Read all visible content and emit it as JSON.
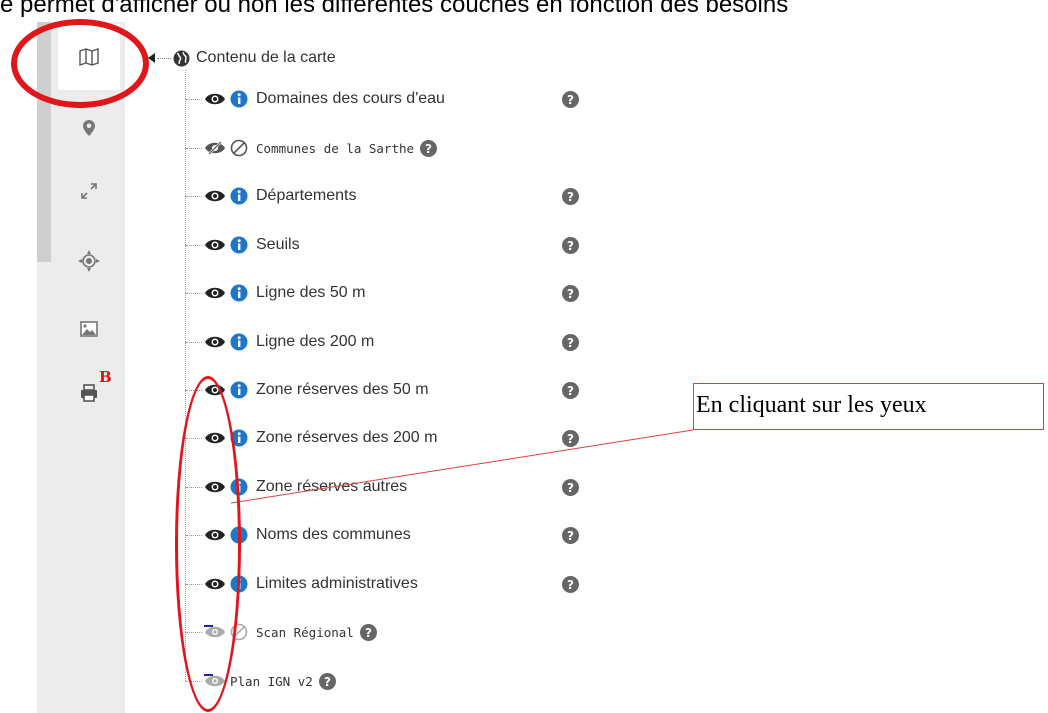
{
  "caption": {
    "text": "e permet d'afficher ou non les différentes couches en fonction des besoins"
  },
  "sidebar": {
    "tools": [
      {
        "id": "map",
        "icon": "map-icon",
        "active": true
      },
      {
        "id": "marker",
        "icon": "map-marker-icon",
        "active": false
      },
      {
        "id": "fullscreen",
        "icon": "expand-icon",
        "active": false
      },
      {
        "id": "locate",
        "icon": "crosshair-icon",
        "active": false
      },
      {
        "id": "image",
        "icon": "image-icon",
        "active": false
      },
      {
        "id": "print",
        "icon": "print-icon",
        "active": false,
        "badge": "B"
      }
    ]
  },
  "tree": {
    "root_label": "Contenu de la carte",
    "layers": [
      {
        "label": "Domaines des cours d'eau",
        "visible": true,
        "info": true,
        "small": false
      },
      {
        "label": "Communes de la Sarthe",
        "visible": false,
        "info": false,
        "small": true
      },
      {
        "label": "Départements",
        "visible": true,
        "info": true,
        "small": false
      },
      {
        "label": "Seuils",
        "visible": true,
        "info": true,
        "small": false
      },
      {
        "label": "Ligne des 50 m",
        "visible": true,
        "info": true,
        "small": false
      },
      {
        "label": "Ligne des 200 m",
        "visible": true,
        "info": true,
        "small": false
      },
      {
        "label": "Zone réserves des 50 m",
        "visible": true,
        "info": true,
        "small": false
      },
      {
        "label": "Zone réserves des 200 m",
        "visible": true,
        "info": true,
        "small": false
      },
      {
        "label": "Zone réserves autres",
        "visible": true,
        "info": true,
        "small": false
      },
      {
        "label": "Noms des communes",
        "visible": true,
        "info": true,
        "small": false
      },
      {
        "label": "Limites administratives",
        "visible": true,
        "info": true,
        "small": false
      },
      {
        "label": "Scan Régional",
        "visible": "dim",
        "info": false,
        "small": true
      },
      {
        "label": "Plan IGN v2",
        "visible": "dim",
        "info": false,
        "small": true
      }
    ]
  },
  "annotation": {
    "text": "En cliquant sur les yeux"
  },
  "colors": {
    "highlight": "#e0161b",
    "info_blue": "#1e77c8",
    "badge_red": "#dd1111"
  }
}
